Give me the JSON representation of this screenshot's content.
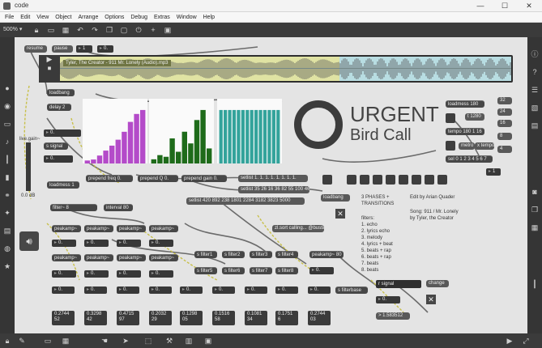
{
  "window": {
    "title": "code",
    "controls": [
      "—",
      "☐",
      "✕"
    ]
  },
  "menu": [
    "File",
    "Edit",
    "View",
    "Object",
    "Arrange",
    "Options",
    "Debug",
    "Extras",
    "Window",
    "Help"
  ],
  "toolbar": {
    "zoom": "500% ▾"
  },
  "transport": {
    "resume": "resume",
    "pause": "pause",
    "n1": "1",
    "n2": "0."
  },
  "waveform": {
    "file": "Tyler, The Creator - 911 Mr. Lonely (Audio).mp3"
  },
  "left": {
    "loadbang": "loadbang",
    "delay": "delay 2",
    "num1": "0.",
    "signal": "s signal",
    "num2": "0.",
    "live_gain": "live.gain~",
    "gain_val": "0.0 dB",
    "loadmess": "loadmess 1",
    "filter": "filter~ 8",
    "interval": "interval 80"
  },
  "prepend": {
    "freq": "prepend freq 0.",
    "q": "prepend Q 0.",
    "gain": "prepend gain 0."
  },
  "lists": {
    "setlist1": "setlist 1. 1. 1. 1. 1. 1. 1. 1.",
    "setlist2": "setlist 35 26 16 36 82 55 100 46",
    "setlist3": "setlist 420 892 238 1801 2284 3182 3823 5000"
  },
  "urgent": {
    "line1": "URGENT",
    "line2": "Bird Call"
  },
  "info": {
    "phases": "3 PHASES +\nTRANSITIONS",
    "edit": "Edit by Arian Quader",
    "song": "Song: 911 / Mr. Lonely\nby Tyler, the Creator",
    "filters": "filters:\n1. echo\n2. lyrics echo\n3. melody\n4. lyrics + beat\n5. beats + rap\n6. beats + rap\n7. beats\n8. beats"
  },
  "right": {
    "loadmess": "loadmess 180",
    "n32": "32",
    "n24": "24",
    "n16": "16",
    "n8": "8",
    "n4": "4",
    "zl": "t 1280",
    "tempo": "tempo 180 1 16",
    "sel": "sel 0 1 2 3 4 5 6 7",
    "metro": "metro",
    "xtempo": "x tempo",
    "n1": "1"
  },
  "loadbang2": "loadbang",
  "zl_word": "zl.sort calling... @busting",
  "peak_label": "peakamp~",
  "peak_val": "0.",
  "mix_label": "peakamp~ 80",
  "filters_row": [
    "s filter1",
    "s filter2",
    "s filter3",
    "s filter4"
  ],
  "filters_row2": [
    "s filter5",
    "s filter6",
    "s filter7",
    "s filter8"
  ],
  "filterbase": "s filterbase",
  "mixer": {
    "signal": "r signal",
    "change": "change",
    "n0": "0.",
    "result": "> 1.583512"
  },
  "values": [
    "0.2744\n52",
    "0.3298\n42",
    "0.4715\n97",
    "0.2032\n29",
    "0.1298\n05",
    "0.1516\n58",
    "0.1081\n34",
    "0.1751\n6",
    "0.2744\n03"
  ],
  "colors": {
    "chart1": "#b44bc9",
    "chart2": "#1e6b1a",
    "chart3": "#33a39b"
  },
  "chart_data": [
    {
      "type": "bar",
      "values": [
        3,
        4,
        8,
        13,
        18,
        24,
        32,
        42,
        50,
        54
      ]
    },
    {
      "type": "bar",
      "values": [
        5,
        10,
        8,
        30,
        14,
        38,
        24,
        52,
        64,
        18
      ]
    },
    {
      "type": "bar",
      "values": [
        60,
        60,
        60,
        60,
        60,
        60,
        60,
        60,
        60,
        60,
        60,
        60,
        60,
        60
      ]
    }
  ]
}
